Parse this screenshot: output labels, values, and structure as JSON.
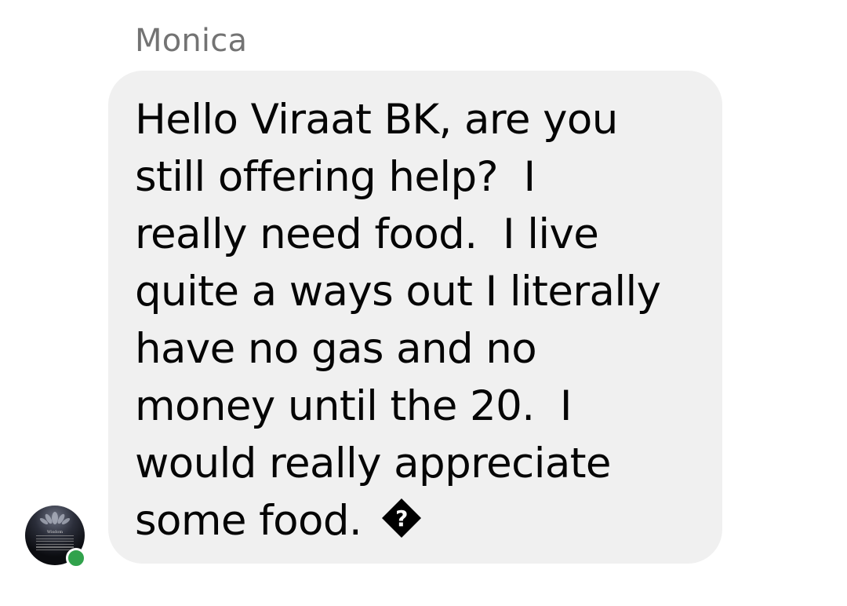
{
  "sender": {
    "name": "Monica",
    "online": true
  },
  "message": {
    "lines": [
      "Hello Viraat BK, are you",
      "still offering help?  I",
      "really need food.  I live",
      "quite a ways out I literally",
      "have no gas and no",
      "money until the 20.  I",
      "would really appreciate",
      "some food. "
    ],
    "trailing_glyph": "replacement-character-icon"
  },
  "avatar": {
    "caption": "Wisdom"
  },
  "colors": {
    "bubble": "#f0f0f0",
    "text": "#050505",
    "sender_name": "#737373",
    "online": "#31a24c"
  }
}
